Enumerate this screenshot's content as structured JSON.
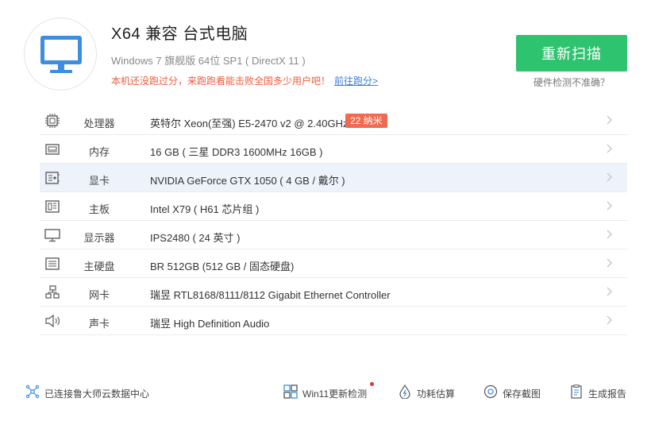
{
  "header": {
    "title": "X64 兼容 台式电脑",
    "subtitle": "Windows 7 旗舰版 64位 SP1 ( DirectX 11 )",
    "promo_text": "本机还没跑过分，来跑跑看能击败全国多少用户吧！",
    "promo_link": "前往跑分>",
    "rescan_label": "重新扫描",
    "inaccurate_label": "硬件检测不准确？"
  },
  "hardware": [
    {
      "icon": "cpu-icon",
      "label": "处理器",
      "value": "英特尔 Xeon(至强) E5-2470 v2 @ 2.40GHz",
      "badge": "22 纳米"
    },
    {
      "icon": "memory-icon",
      "label": "内存",
      "value": "16 GB ( 三星 DDR3 1600MHz 16GB )"
    },
    {
      "icon": "gpu-icon",
      "label": "显卡",
      "value": "NVIDIA GeForce GTX 1050 ( 4 GB / 戴尔 )",
      "selected": true
    },
    {
      "icon": "motherboard-icon",
      "label": "主板",
      "value": "Intel X79 ( H61 芯片组 )"
    },
    {
      "icon": "monitor-icon",
      "label": "显示器",
      "value": "IPS2480 ( 24 英寸 )"
    },
    {
      "icon": "harddisk-icon",
      "label": "主硬盘",
      "value": "BR 512GB (512 GB / 固态硬盘)"
    },
    {
      "icon": "network-icon",
      "label": "网卡",
      "value": "瑞昱 RTL8168/8111/8112 Gigabit Ethernet Controller"
    },
    {
      "icon": "speaker-icon",
      "label": "声卡",
      "value": "瑞昱 High Definition Audio"
    }
  ],
  "footer": {
    "cloud_status": "已连接鲁大师云数据中心",
    "win11_check": "Win11更新检测",
    "power_estimate": "功耗估算",
    "save_screenshot": "保存截图",
    "generate_report": "生成报告"
  },
  "colors": {
    "accent_green": "#2ec36f",
    "promo_red": "#f05a3c",
    "badge_red": "#f06a4f",
    "link_blue": "#3b7fd6",
    "icon_blue": "#3d8ee0",
    "selected_row": "#eef2fb"
  }
}
